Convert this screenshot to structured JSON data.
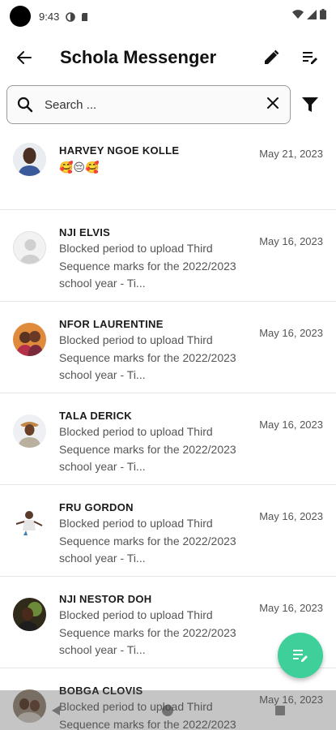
{
  "status_bar": {
    "time": "9:43"
  },
  "app_bar": {
    "title": "Schola Messenger"
  },
  "search": {
    "placeholder": "Search ..."
  },
  "conversations": [
    {
      "name": "HARVEY NGOE KOLLE",
      "message": "🥰😔🥰",
      "date": "May 21, 2023"
    },
    {
      "name": "NJI ELVIS",
      "message": "Blocked period to upload Third Sequence marks for the 2022/2023 school year - Ti...",
      "date": "May 16, 2023"
    },
    {
      "name": "NFOR LAURENTINE",
      "message": "Blocked period to upload Third Sequence marks for the 2022/2023 school year - Ti...",
      "date": "May 16, 2023"
    },
    {
      "name": "TALA DERICK",
      "message": "Blocked period to upload Third Sequence marks for the 2022/2023 school year - Ti...",
      "date": "May 16, 2023"
    },
    {
      "name": "FRU GORDON",
      "message": "Blocked period to upload Third Sequence marks for the 2022/2023 school year - Ti...",
      "date": "May 16, 2023"
    },
    {
      "name": "NJI NESTOR DOH",
      "message": "Blocked period to upload Third Sequence marks for the 2022/2023 school year - Ti...",
      "date": "May 16, 2023"
    },
    {
      "name": "BOBGA CLOVIS",
      "message": "Blocked period to upload Third Sequence marks for the 2022/2023",
      "date": "May 16, 2023"
    }
  ],
  "colors": {
    "fab": "#3ecf9b",
    "accent_text": "#1a1a1a"
  }
}
